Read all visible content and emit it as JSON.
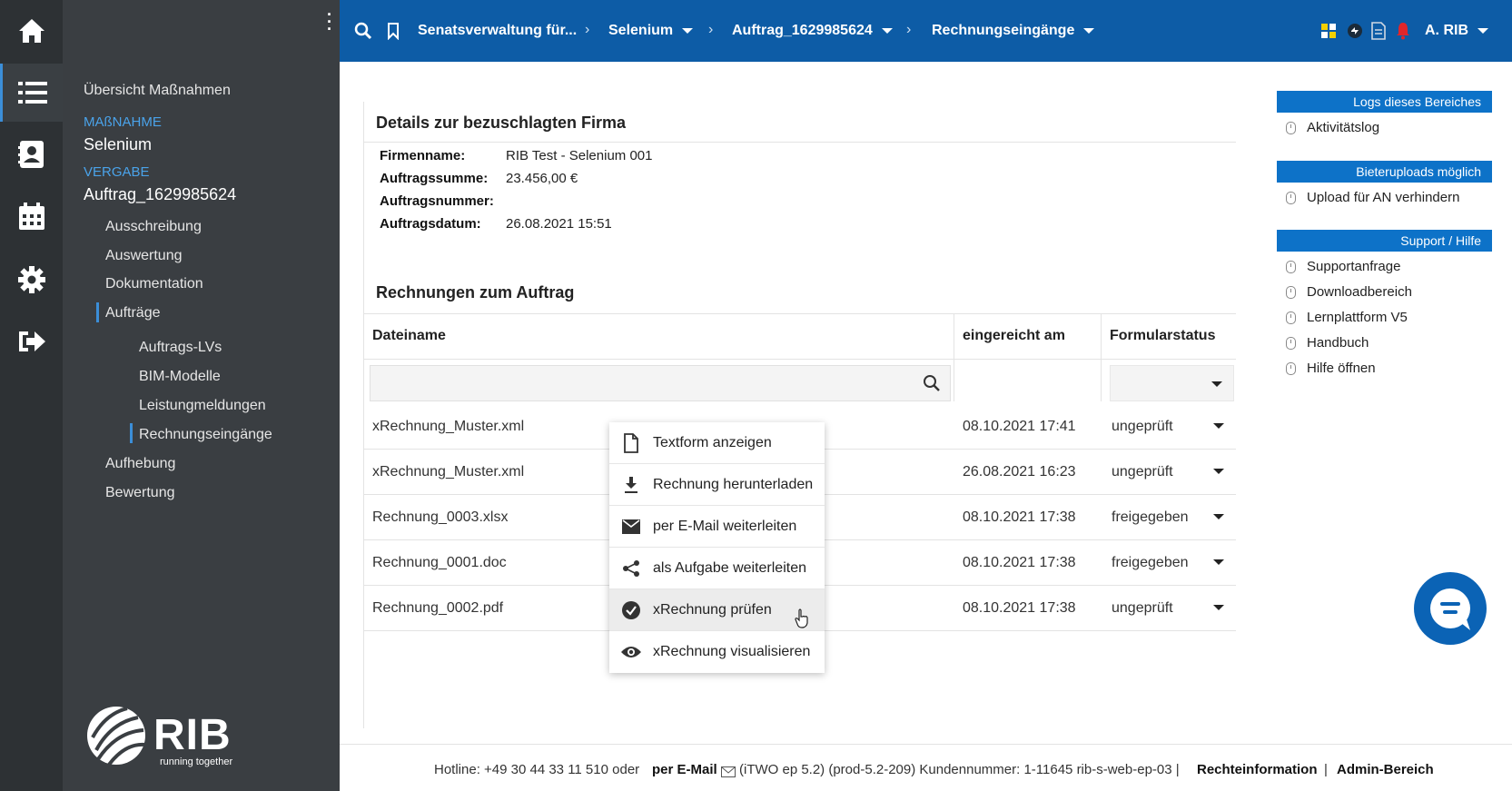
{
  "rail": {
    "icons": [
      "home-icon",
      "list-icon",
      "contacts-icon",
      "calendar-icon",
      "settings-icon",
      "logout-icon"
    ]
  },
  "leftnav": {
    "overview": "Übersicht Maßnahmen",
    "massnahme_cap": "MAßNAHME",
    "massnahme_val": "Selenium",
    "vergabe_cap": "VERGABE",
    "vergabe_val": "Auftrag_1629985624",
    "items": [
      "Ausschreibung",
      "Auswertung",
      "Dokumentation",
      "Aufträge"
    ],
    "subitems": [
      "Auftrags-LVs",
      "BIM-Modelle",
      "Leistungmeldungen",
      "Rechnungseingänge"
    ],
    "items2": [
      "Aufhebung",
      "Bewertung"
    ],
    "logo_text": "RIB",
    "logo_sub": "running together"
  },
  "topbar": {
    "crumbs": [
      "Senatsverwaltung für...",
      "Selenium",
      "Auftrag_1629985624",
      "Rechnungseingänge"
    ],
    "user": "A. RIB"
  },
  "details": {
    "title": "Details zur bezuschlagten Firma",
    "rows": [
      {
        "k": "Firmenname:",
        "v": "RIB Test - Selenium 001"
      },
      {
        "k": "Auftragssumme:",
        "v": "23.456,00 €"
      },
      {
        "k": "Auftragsnummer:",
        "v": ""
      },
      {
        "k": "Auftragsdatum:",
        "v": "26.08.2021 15:51"
      }
    ]
  },
  "invoices": {
    "title": "Rechnungen zum Auftrag",
    "headers": [
      "Dateiname",
      "eingereicht am",
      "Formularstatus"
    ],
    "rows": [
      {
        "name": "xRechnung_Muster.xml",
        "date": "08.10.2021 17:41",
        "status": "ungeprüft"
      },
      {
        "name": "xRechnung_Muster.xml",
        "date": "26.08.2021 16:23",
        "status": "ungeprüft"
      },
      {
        "name": "Rechnung_0003.xlsx",
        "date": "08.10.2021 17:38",
        "status": "freigegeben"
      },
      {
        "name": "Rechnung_0001.doc",
        "date": "08.10.2021 17:38",
        "status": "freigegeben"
      },
      {
        "name": "Rechnung_0002.pdf",
        "date": "08.10.2021 17:38",
        "status": "ungeprüft"
      }
    ]
  },
  "context_menu": {
    "items": [
      {
        "label": "Textform anzeigen",
        "icon": "document-icon"
      },
      {
        "label": "Rechnung herunterladen",
        "icon": "download-icon"
      },
      {
        "label": "per E-Mail weiterleiten",
        "icon": "mail-icon"
      },
      {
        "label": "als Aufgabe weiterleiten",
        "icon": "share-icon"
      },
      {
        "label": "xRechnung prüfen",
        "icon": "check-circle-icon"
      },
      {
        "label": "xRechnung visualisieren",
        "icon": "eye-icon"
      }
    ]
  },
  "right": {
    "sections": [
      {
        "title": "Logs dieses Bereiches",
        "links": [
          "Aktivitätslog"
        ]
      },
      {
        "title": "Bieteruploads möglich",
        "links": [
          "Upload für AN verhindern"
        ]
      },
      {
        "title": "Support / Hilfe",
        "links": [
          "Supportanfrage",
          "Downloadbereich",
          "Lernplattform V5",
          "Handbuch",
          "Hilfe öffnen"
        ]
      }
    ]
  },
  "footer": {
    "hotline": "Hotline: +49 30 44 33 11 510 oder",
    "email": "per E-Mail",
    "version": "(iTWO ep 5.2) (prod-5.2-209)   Kundennummer: 1-11645 rib-s-web-ep-03 |",
    "rechte": "Rechteinformation",
    "sep": "|",
    "admin": "Admin-Bereich"
  },
  "colors": {
    "topbar": "#0d5ca6",
    "accent": "#3b8ed8",
    "sidebar": "#3a3e42",
    "rail": "#2d3134"
  }
}
